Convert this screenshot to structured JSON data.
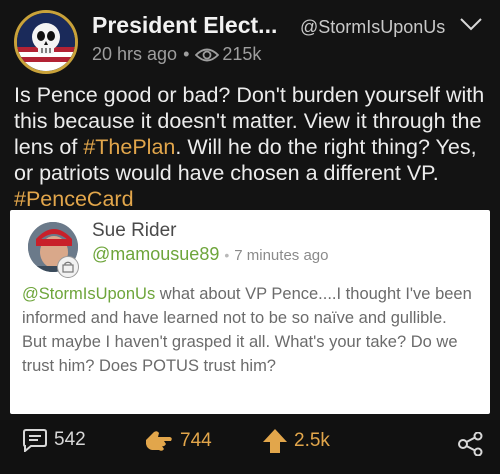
{
  "post": {
    "author_name": "President Elect...",
    "author_handle": "@StormIsUponUs",
    "time": "20 hrs ago",
    "separator": "•",
    "views": "215k",
    "body_parts": [
      {
        "text": "Is Pence good or bad? Don't burden yourself with this because it doesn't matter. View it through the lens of ",
        "tag": false
      },
      {
        "text": "#ThePlan",
        "tag": true
      },
      {
        "text": ". Will he do the right thing? Yes, or patriots would have chosen a different VP. ",
        "tag": false
      },
      {
        "text": "#PenceCard",
        "tag": true
      }
    ]
  },
  "quoted": {
    "name": "Sue Rider",
    "handle": "@mamousue89",
    "separator": "•",
    "time": "7 minutes ago",
    "mention": "@StormIsUponUs",
    "text_line1": " what about VP Pence....I thought I've been informed and have learned not to be so naïve and gullible.",
    "text_line2": "But maybe I haven't grasped it all. What's your take? Do we trust him? Does POTUS trust him?"
  },
  "actions": {
    "comments": "542",
    "likes": "744",
    "upvotes": "2.5k"
  },
  "colors": {
    "accent": "#e2a64b",
    "handle_green": "#6ea53b",
    "background": "#131313"
  },
  "icons": {
    "views": "eye-icon",
    "comments": "comment-icon",
    "likes": "pointing-hand-icon",
    "upvotes": "up-arrow-icon",
    "share": "share-icon",
    "menu": "chevron-down-icon"
  }
}
